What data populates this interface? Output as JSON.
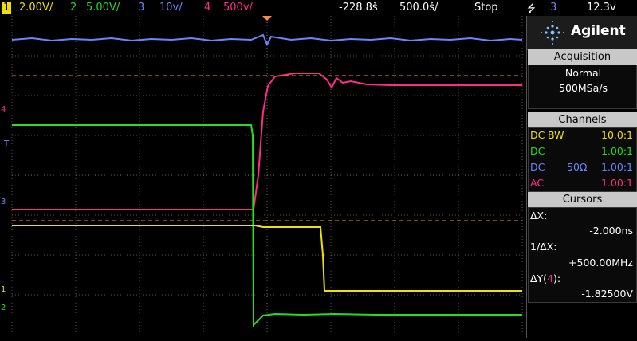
{
  "topbar": {
    "ch1_num": "1",
    "ch1_scale": "2.00V/",
    "ch2_num": "2",
    "ch2_scale": "5.00V/",
    "ch3_num": "3",
    "ch3_scale": "10ⅴ/",
    "ch4_num": "4",
    "ch4_scale": "500ⅴ/",
    "time_offset": "-228.8š",
    "timebase": "500.0š/",
    "run_state": "Stop",
    "trigger_channel": "3",
    "trigger_level": "12.3ⅴ"
  },
  "logo": {
    "brand": "Agilent"
  },
  "acquisition": {
    "title": "Acquisition",
    "mode": "Normal",
    "rate": "500MSa/s"
  },
  "channels": {
    "title": "Channels",
    "rows": [
      {
        "coupling": "DC",
        "bw": "BW",
        "impedance": "",
        "probe": "10.0:1",
        "color": "#f0e000"
      },
      {
        "coupling": "DC",
        "bw": "",
        "impedance": "",
        "probe": "1.00:1",
        "color": "#20e020"
      },
      {
        "coupling": "DC",
        "bw": "",
        "impedance": "50Ω",
        "probe": "1.00:1",
        "color": "#6a86ff"
      },
      {
        "coupling": "AC",
        "bw": "",
        "impedance": "",
        "probe": "1.00:1",
        "color": "#ff2a8a"
      }
    ]
  },
  "cursors": {
    "title": "Cursors",
    "dx_label": "ΔX:",
    "dx_value": "-2.000ns",
    "inv_dx_label": "1/ΔX:",
    "inv_dx_value": "+500.00MHz",
    "dy_label_pre": "ΔY(",
    "dy_channel": "4",
    "dy_label_post": "):",
    "dy_value": "-1.82500V"
  },
  "markers": {
    "ch4": "4",
    "trigger": "T",
    "ch3": "3",
    "ch1": "1",
    "ch2": "2"
  },
  "colors": {
    "ch1": "#f0e000",
    "ch2": "#20e020",
    "ch3": "#6a86ff",
    "ch4": "#ff2a8a",
    "cursor": "#ff8a3a",
    "grid": "#555555"
  }
}
